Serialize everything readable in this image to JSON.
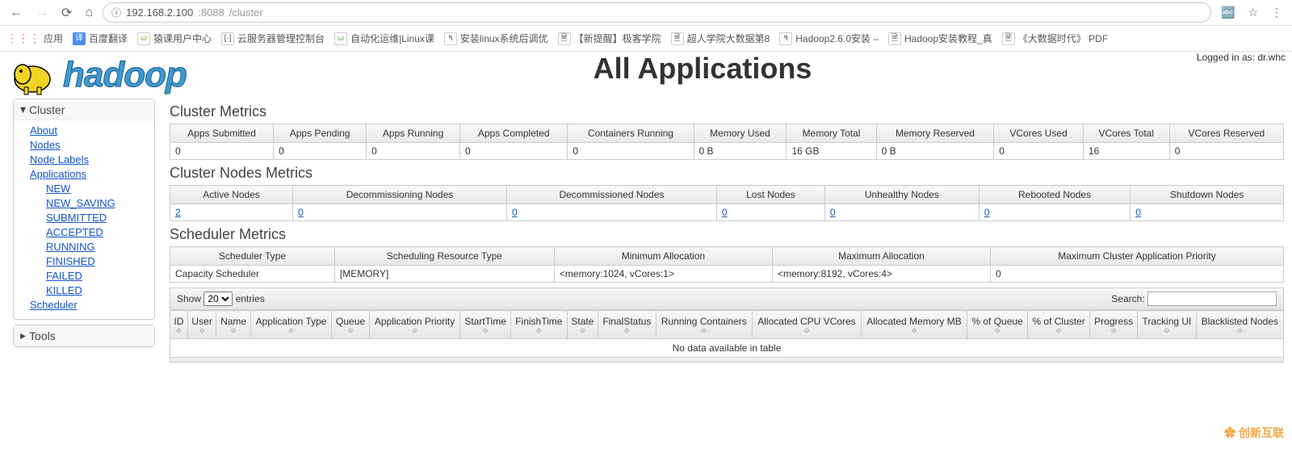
{
  "browser": {
    "url_host": "192.168.2.100",
    "url_port": ":8088",
    "url_path": "/cluster"
  },
  "bookmarks": {
    "apps_label": "应用",
    "items": [
      "百度翻译",
      "猿课用户中心",
      "云服务器管理控制台",
      "自动化运维|Linux课",
      "安装linux系统后调优",
      "【新提醒】极客学院",
      "超人学院大数据第8",
      "Hadoop2.6.0安装 –",
      "Hadoop安装教程_真",
      "《大数据时代》 PDF"
    ]
  },
  "login": {
    "prefix": "Logged in as: ",
    "user": "dr.whc"
  },
  "title": "All Applications",
  "sidebar": {
    "cluster_label": "Cluster",
    "links": {
      "about": "About",
      "nodes": "Nodes",
      "node_labels": "Node Labels",
      "applications": "Applications",
      "scheduler": "Scheduler"
    },
    "app_states": [
      "NEW",
      "NEW_SAVING",
      "SUBMITTED",
      "ACCEPTED",
      "RUNNING",
      "FINISHED",
      "FAILED",
      "KILLED"
    ],
    "tools_label": "Tools"
  },
  "cluster_metrics": {
    "title": "Cluster Metrics",
    "headers": [
      "Apps Submitted",
      "Apps Pending",
      "Apps Running",
      "Apps Completed",
      "Containers Running",
      "Memory Used",
      "Memory Total",
      "Memory Reserved",
      "VCores Used",
      "VCores Total",
      "VCores Reserved"
    ],
    "values": [
      "0",
      "0",
      "0",
      "0",
      "0",
      "0 B",
      "16 GB",
      "0 B",
      "0",
      "16",
      "0"
    ]
  },
  "nodes_metrics": {
    "title": "Cluster Nodes Metrics",
    "headers": [
      "Active Nodes",
      "Decommissioning Nodes",
      "Decommissioned Nodes",
      "Lost Nodes",
      "Unhealthy Nodes",
      "Rebooted Nodes",
      "Shutdown Nodes"
    ],
    "values": [
      "2",
      "0",
      "0",
      "0",
      "0",
      "0",
      "0"
    ]
  },
  "scheduler_metrics": {
    "title": "Scheduler Metrics",
    "headers": [
      "Scheduler Type",
      "Scheduling Resource Type",
      "Minimum Allocation",
      "Maximum Allocation",
      "Maximum Cluster Application Priority"
    ],
    "values": [
      "Capacity Scheduler",
      "[MEMORY]",
      "<memory:1024, vCores:1>",
      "<memory:8192, vCores:4>",
      "0"
    ]
  },
  "datatable": {
    "show_label": "Show ",
    "show_value": "20",
    "entries_label": " entries",
    "search_label": "Search:",
    "headers": [
      "ID",
      "User",
      "Name",
      "Application Type",
      "Queue",
      "Application Priority",
      "StartTime",
      "FinishTime",
      "State",
      "FinalStatus",
      "Running Containers",
      "Allocated CPU VCores",
      "Allocated Memory MB",
      "% of Queue",
      "% of Cluster",
      "Progress",
      "Tracking UI",
      "Blacklisted Nodes"
    ],
    "no_data": "No data available in table"
  },
  "watermark": "创新互联"
}
